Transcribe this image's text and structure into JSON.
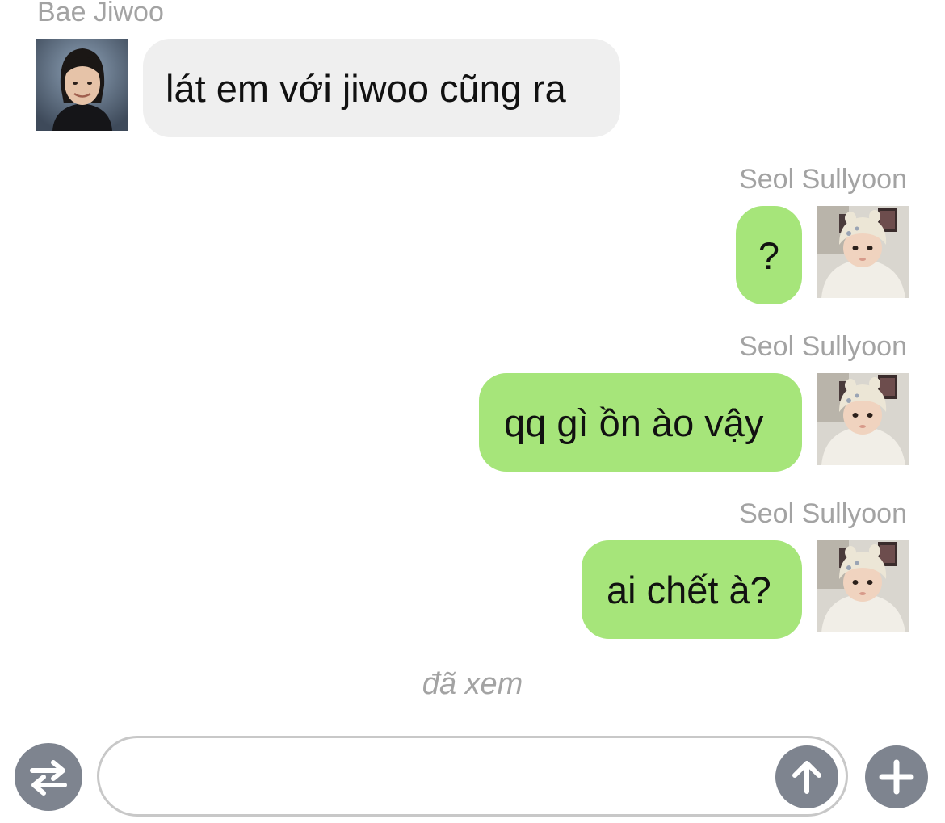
{
  "messages": [
    {
      "sender": "Bae Jiwoo",
      "text": "lát em với jiwoo cũng ra",
      "direction": "incoming"
    },
    {
      "sender": "Seol Sullyoon",
      "text": "?",
      "direction": "outgoing"
    },
    {
      "sender": "Seol Sullyoon",
      "text": "qq gì ồn ào vậy",
      "direction": "outgoing"
    },
    {
      "sender": "Seol Sullyoon",
      "text": "ai chết à?",
      "direction": "outgoing"
    }
  ],
  "read_receipt": "đã xem",
  "composer": {
    "value": "",
    "placeholder": ""
  },
  "icons": {
    "switch": "swap-arrows-icon",
    "send": "arrow-up-icon",
    "add": "plus-icon"
  },
  "colors": {
    "incoming_bubble": "#efefef",
    "outgoing_bubble": "#a6e57a",
    "meta_text": "#a3a3a3",
    "button_gray": "#7e848f"
  }
}
